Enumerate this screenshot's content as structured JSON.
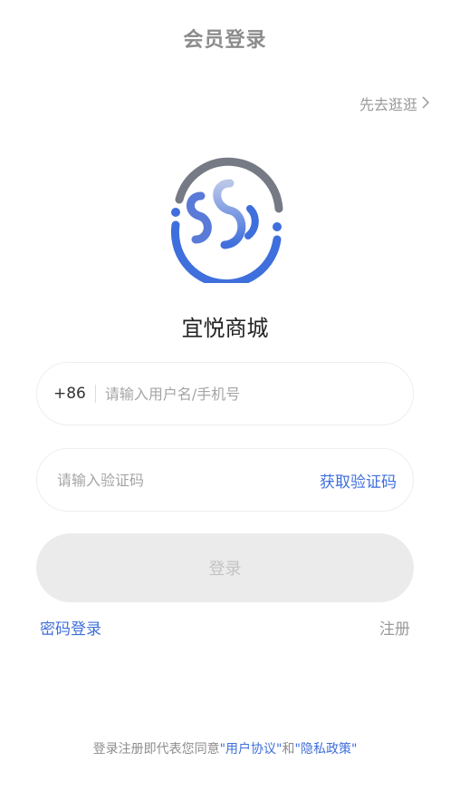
{
  "header": {
    "title": "会员登录"
  },
  "skip": {
    "label": "先去逛逛",
    "icon": "chevron-right-icon"
  },
  "brand": {
    "name": "宜悦商城",
    "logo": "yiyue-logo"
  },
  "phone_field": {
    "prefix": "+86",
    "placeholder": "请输入用户名/手机号",
    "value": ""
  },
  "code_field": {
    "placeholder": "请输入验证码",
    "value": "",
    "get_code_label": "获取验证码"
  },
  "login_button": {
    "label": "登录"
  },
  "links": {
    "password_login": "密码登录",
    "register": "注册"
  },
  "agreement": {
    "prefix": "登录注册即代表您同意",
    "user_agreement": "\"用户协议\"",
    "and": "和",
    "privacy_policy": "\"隐私政策\""
  },
  "colors": {
    "accent": "#3f6fdc",
    "logo_gray": "#7c7c7c",
    "logo_blue": "#3f6fdc",
    "button_disabled": "#ebebeb"
  }
}
